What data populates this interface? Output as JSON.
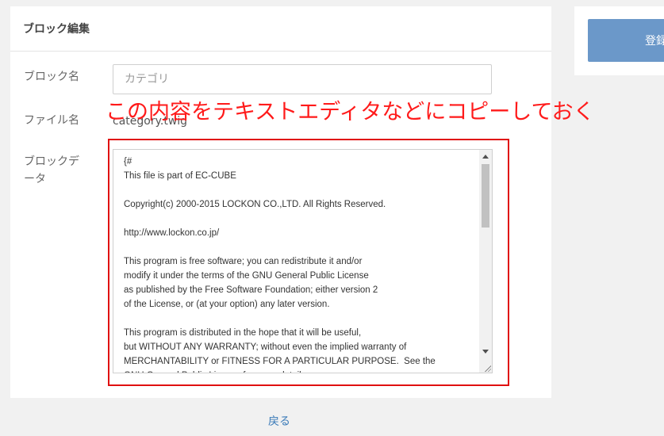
{
  "card": {
    "title": "ブロック編集"
  },
  "form": {
    "block_name_label": "ブロック名",
    "block_name_placeholder": "カテゴリ",
    "file_name_label": "ファイル名",
    "file_name_value": "category.twig",
    "block_data_label": "ブロックデータ",
    "block_data_lines": [
      "{#",
      "This file is part of EC-CUBE",
      "",
      "Copyright(c) 2000-2015 LOCKON CO.,LTD. All Rights Reserved.",
      "",
      "http://www.lockon.co.jp/",
      "",
      "This program is free software; you can redistribute it and/or",
      "modify it under the terms of the GNU General Public License",
      "as published by the Free Software Foundation; either version 2",
      "of the License, or (at your option) any later version.",
      "",
      "This program is distributed in the hope that it will be useful,",
      "but WITHOUT ANY WARRANTY; without even the implied warranty of",
      "MERCHANTABILITY or FITNESS FOR A PARTICULAR PURPOSE.  See the",
      "GNU General Public License for more details."
    ]
  },
  "annotation": {
    "text": "この内容をテキストエディタなどにコピーしておく",
    "color": "#ff1a1a"
  },
  "footer": {
    "back_label": "戻る"
  },
  "side": {
    "register_label": "登録"
  }
}
